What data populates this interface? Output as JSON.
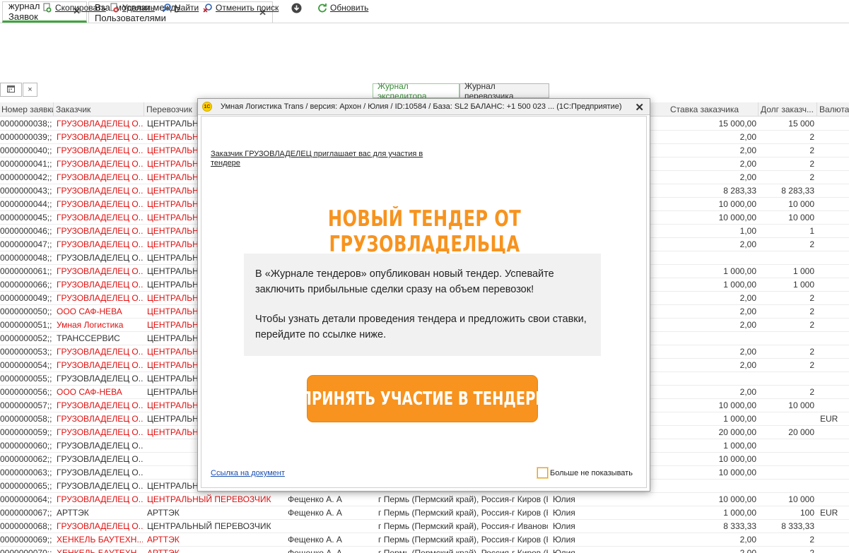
{
  "tabs": [
    {
      "label": "журнал Заявок",
      "close": "✕",
      "active": true
    },
    {
      "label": "Взаимосвязи между Пользователями",
      "close": "✕",
      "active": false
    }
  ],
  "toolbar": {
    "calendar_icon": "calendar-icon",
    "clear": "×",
    "copy": "Скопировать",
    "delete": "Удалить",
    "find": "Найти",
    "cancel_search": "Отменить поиск",
    "refresh": "Обновить",
    "journal_expeditor": "Журнал экспедитора",
    "journal_carrier": "Журнал перевозчика"
  },
  "columns": [
    "Номер заявки",
    "Заказчик",
    "Перевозчик",
    "Ставка заказчика",
    "Долг заказч...",
    "Валюта..."
  ],
  "rows": [
    {
      "num": "0000000038;;",
      "cust": "ГРУЗОВЛАДЕЛЕЦ О...",
      "cust_red": true,
      "carr": "ЦЕНТРАЛЬНЫЙ",
      "carr_red": false,
      "rate": "15 000,00",
      "debt": "15 000",
      "cur": ""
    },
    {
      "num": "0000000039;;",
      "cust": "ГРУЗОВЛАДЕЛЕЦ О...",
      "cust_red": true,
      "carr": "ЦЕНТРАЛЬНЫЙ",
      "carr_red": true,
      "rate": "2,00",
      "debt": "2",
      "cur": ""
    },
    {
      "num": "0000000040;;",
      "cust": "ГРУЗОВЛАДЕЛЕЦ О...",
      "cust_red": true,
      "carr": "ЦЕНТРАЛЬНЫЙ",
      "carr_red": true,
      "rate": "2,00",
      "debt": "2",
      "cur": ""
    },
    {
      "num": "0000000041;;",
      "cust": "ГРУЗОВЛАДЕЛЕЦ О...",
      "cust_red": true,
      "carr": "ЦЕНТРАЛЬНЫЙ",
      "carr_red": true,
      "rate": "2,00",
      "debt": "2",
      "cur": ""
    },
    {
      "num": "0000000042;;",
      "cust": "ГРУЗОВЛАДЕЛЕЦ О...",
      "cust_red": true,
      "carr": "ЦЕНТРАЛЬНЫЙ",
      "carr_red": true,
      "rate": "2,00",
      "debt": "2",
      "cur": ""
    },
    {
      "num": "0000000043;;",
      "cust": "ГРУЗОВЛАДЕЛЕЦ О...",
      "cust_red": true,
      "carr": "ЦЕНТРАЛЬНЫЙ",
      "carr_red": true,
      "rate": "8 283,33",
      "debt": "8 283,33",
      "cur": ""
    },
    {
      "num": "0000000044;;",
      "cust": "ГРУЗОВЛАДЕЛЕЦ О...",
      "cust_red": true,
      "carr": "ЦЕНТРАЛЬНЫЙ",
      "carr_red": true,
      "rate": "10 000,00",
      "debt": "10 000",
      "cur": ""
    },
    {
      "num": "0000000045;;",
      "cust": "ГРУЗОВЛАДЕЛЕЦ О...",
      "cust_red": true,
      "carr": "ЦЕНТРАЛЬНЫЙ",
      "carr_red": true,
      "rate": "10 000,00",
      "debt": "10 000",
      "cur": ""
    },
    {
      "num": "0000000046;;",
      "cust": "ГРУЗОВЛАДЕЛЕЦ О...",
      "cust_red": true,
      "carr": "ЦЕНТРАЛЬНЫЙ",
      "carr_red": true,
      "rate": "1,00",
      "debt": "1",
      "cur": ""
    },
    {
      "num": "0000000047;;",
      "cust": "ГРУЗОВЛАДЕЛЕЦ О...",
      "cust_red": true,
      "carr": "ЦЕНТРАЛЬНЫЙ",
      "carr_red": true,
      "rate": "2,00",
      "debt": "2",
      "cur": ""
    },
    {
      "num": "0000000048;;",
      "cust": "ГРУЗОВЛАДЕЛЕЦ О...",
      "cust_red": false,
      "carr": "ЦЕНТРАЛЬНЫЙ",
      "carr_red": false,
      "rate": "",
      "debt": "",
      "cur": ""
    },
    {
      "num": "0000000061;;",
      "cust": "ГРУЗОВЛАДЕЛЕЦ О...",
      "cust_red": true,
      "carr": "ЦЕНТРАЛЬНЫЙ",
      "carr_red": false,
      "rate": "1 000,00",
      "debt": "1 000",
      "cur": ""
    },
    {
      "num": "0000000066;;",
      "cust": "ГРУЗОВЛАДЕЛЕЦ О...",
      "cust_red": true,
      "carr": "ЦЕНТРАЛЬНЫЙ",
      "carr_red": false,
      "rate": "1 000,00",
      "debt": "1 000",
      "cur": ""
    },
    {
      "num": "0000000049;;",
      "cust": "ГРУЗОВЛАДЕЛЕЦ О...",
      "cust_red": true,
      "carr": "ЦЕНТРАЛЬНЫЙ",
      "carr_red": true,
      "rate": "2,00",
      "debt": "2",
      "cur": ""
    },
    {
      "num": "0000000050;;",
      "cust": "ООО САФ-НЕВА",
      "cust_red": true,
      "carr": "ЦЕНТРАЛЬНЫЙ",
      "carr_red": true,
      "rate": "2,00",
      "debt": "2",
      "cur": ""
    },
    {
      "num": "0000000051;;",
      "cust": "Умная Логистика",
      "cust_red": true,
      "carr": "ЦЕНТРАЛЬНЫЙ",
      "carr_red": true,
      "rate": "2,00",
      "debt": "2",
      "cur": ""
    },
    {
      "num": "0000000052;;",
      "cust": "ТРАНССЕРВИС",
      "cust_red": false,
      "carr": "ЦЕНТРАЛЬНЫЙ",
      "carr_red": false,
      "rate": "",
      "debt": "",
      "cur": ""
    },
    {
      "num": "0000000053;;",
      "cust": "ГРУЗОВЛАДЕЛЕЦ О...",
      "cust_red": true,
      "carr": "ЦЕНТРАЛЬНЫЙ",
      "carr_red": true,
      "rate": "2,00",
      "debt": "2",
      "cur": ""
    },
    {
      "num": "0000000054;;",
      "cust": "ГРУЗОВЛАДЕЛЕЦ О...",
      "cust_red": true,
      "carr": "ЦЕНТРАЛЬНЫЙ",
      "carr_red": true,
      "rate": "2,00",
      "debt": "2",
      "cur": ""
    },
    {
      "num": "0000000055;;",
      "cust": "ГРУЗОВЛАДЕЛЕЦ О...",
      "cust_red": false,
      "carr": "ЦЕНТРАЛЬНЫЙ",
      "carr_red": false,
      "rate": "",
      "debt": "",
      "cur": ""
    },
    {
      "num": "0000000056;;",
      "cust": "ООО САФ-НЕВА",
      "cust_red": true,
      "carr": "ЦЕНТРАЛЬНЫЙ",
      "carr_red": false,
      "rate": "2,00",
      "debt": "2",
      "cur": ""
    },
    {
      "num": "0000000057;;",
      "cust": "ГРУЗОВЛАДЕЛЕЦ О...",
      "cust_red": true,
      "carr": "ЦЕНТРАЛЬНЫЙ",
      "carr_red": true,
      "rate": "10 000,00",
      "debt": "10 000",
      "cur": ""
    },
    {
      "num": "0000000058;;",
      "cust": "ГРУЗОВЛАДЕЛЕЦ О...",
      "cust_red": true,
      "carr": "ЦЕНТРАЛЬНЫЙ",
      "carr_red": false,
      "rate": "1 000,00",
      "debt": "",
      "cur": "EUR"
    },
    {
      "num": "0000000059;;",
      "cust": "ГРУЗОВЛАДЕЛЕЦ О...",
      "cust_red": true,
      "carr": "ЦЕНТРАЛЬНЫЙ",
      "carr_red": true,
      "rate": "20 000,00",
      "debt": "20 000",
      "cur": ""
    },
    {
      "num": "0000000060;;",
      "cust": "ГРУЗОВЛАДЕЛЕЦ О...",
      "cust_red": false,
      "carr": "",
      "carr_red": false,
      "rate": "1 000,00",
      "debt": "",
      "cur": ""
    },
    {
      "num": "0000000062;;",
      "cust": "ГРУЗОВЛАДЕЛЕЦ О...",
      "cust_red": false,
      "carr": "",
      "carr_red": false,
      "rate": "10 000,00",
      "debt": "",
      "cur": ""
    },
    {
      "num": "0000000063;;",
      "cust": "ГРУЗОВЛАДЕЛЕЦ О...",
      "cust_red": false,
      "carr": "",
      "carr_red": false,
      "rate": "10 000,00",
      "debt": "",
      "cur": ""
    },
    {
      "num": "0000000065;;",
      "cust": "ГРУЗОВЛАДЕЛЕЦ О...",
      "cust_red": false,
      "carr": "ЦЕНТРАЛЬНЫЙ",
      "carr_red": false,
      "rate": "",
      "debt": "",
      "cur": ""
    }
  ],
  "bottom_rows": [
    {
      "num": "0000000064;;",
      "cust": "ГРУЗОВЛАДЕЛЕЦ О...",
      "cust_red": true,
      "carr": "ЦЕНТРАЛЬНЫЙ ПЕРЕВОЗЧИК",
      "carr_red": true,
      "person": "Фещенко А. А",
      "route": "г Пермь (Пермский край), Россия-г Киров (К...",
      "user": "Юлия",
      "rate": "10 000,00",
      "debt": "10 000",
      "cur": ""
    },
    {
      "num": "0000000067;;",
      "cust": "АРТТЭК",
      "cust_red": false,
      "carr": "АРТТЭК",
      "carr_red": false,
      "person": "Фещенко А. А",
      "route": "г Пермь (Пермский край), Россия-г Киров (К...",
      "user": "Юлия",
      "rate": "1 000,00",
      "debt": "100",
      "cur": "EUR"
    },
    {
      "num": "0000000068;;",
      "cust": "ГРУЗОВЛАДЕЛЕЦ О...",
      "cust_red": true,
      "carr": "ЦЕНТРАЛЬНЫЙ ПЕРЕВОЗЧИК",
      "carr_red": false,
      "person": "",
      "route": "г Пермь (Пермский край), Россия-г Иваново...",
      "user": "Юлия",
      "rate": "8 333,33",
      "debt": "8 333,33",
      "cur": ""
    },
    {
      "num": "0000000069;;",
      "cust": "ХЕНКЕЛЬ БАУТЕХН...",
      "cust_red": true,
      "carr": "АРТТЭК",
      "carr_red": true,
      "person": "Фещенко А. А",
      "route": "г Пермь (Пермский край), Россия-г Киров (К...",
      "user": "Юлия",
      "rate": "2,00",
      "debt": "2",
      "cur": ""
    },
    {
      "num": "0000000070;;",
      "cust": "ХЕНКЕЛЬ БАУТЕХН...",
      "cust_red": true,
      "carr": "АРТТЭК",
      "carr_red": true,
      "person": "Фещенко А. А",
      "route": "г Пермь (Пермский край), Россия-г Киров (К...",
      "user": "Юлия",
      "rate": "2,00",
      "debt": "2",
      "cur": ""
    }
  ],
  "modal": {
    "logo": "1С",
    "title": "Умная Логистика Trans / версия: Архон / Юлия / ID:10584 / База: SL2 БАЛАНС: +1 500 023 ...  (1С:Предприятие)",
    "close": "✕",
    "invite": "Заказчик ГРУЗОВЛАДЕЛЕЦ приглашает вас для участия в тендере",
    "headline": "НОВЫЙ ТЕНДЕР ОТ ГРУЗОВЛАДЕЛЬЦА",
    "paragraph1": "В «Журнале тендеров» опубликован новый тендер. Успевайте заключить прибыльные сделки сразу на объем перевозок!",
    "paragraph2": "Чтобы узнать детали проведения тендера и предложить свои ставки, перейдите по ссылке ниже.",
    "cta": "ПРИНЯТЬ УЧАСТИЕ В ТЕНДЕРЕ",
    "doc_link": "Ссылка на документ",
    "dont_show": "Больше не показывать"
  },
  "colors": {
    "accent_orange": "#f7931e",
    "red_text": "#e01010",
    "active_tab": "#3ea53e"
  }
}
